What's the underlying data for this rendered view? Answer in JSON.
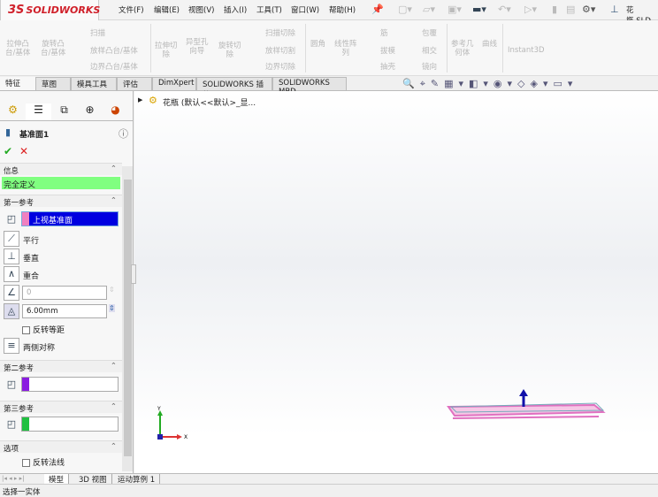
{
  "app": {
    "logo_ds": "3S",
    "logo_text": "SOLIDWORKS",
    "doc_title": "花瓶.SLD"
  },
  "menu": [
    "文件(F)",
    "编辑(E)",
    "视图(V)",
    "插入(I)",
    "工具(T)",
    "窗口(W)",
    "帮助(H)"
  ],
  "ribbon": {
    "extrude_boss": "拉伸凸\n台/基体",
    "revolve_boss": "旋转凸\n台/基体",
    "sweep": "扫描",
    "loft": "放样凸台/基体",
    "boundary": "边界凸台/基体",
    "extrude_cut": "拉伸切\n除",
    "hole_wizard": "异型孔\n向导",
    "revolve_cut": "旋转切\n除",
    "swept_cut": "扫描切除",
    "lofted_cut": "放样切割",
    "boundary_cut": "边界切除",
    "fillet": "圆角",
    "linear_pattern": "线性阵\n列",
    "rib": "筋",
    "draft": "拔模",
    "shell": "抽壳",
    "wrap": "包覆",
    "intersect": "相交",
    "mirror": "镜向",
    "ref_geometry": "参考几\n何体",
    "curves": "曲线",
    "instant3d": "Instant3D"
  },
  "tabs": [
    "特征",
    "草图",
    "模具工具",
    "评估",
    "DimXpert",
    "SOLIDWORKS 插件",
    "SOLIDWORKS MBD"
  ],
  "tree": {
    "root": "花瓶  (默认<<默认>_显..."
  },
  "panel": {
    "title": "基准面1",
    "info_header": "信息",
    "info_status": "完全定义",
    "ref1_header": "第一参考",
    "ref1_value": "上视基准面",
    "parallel": "平行",
    "perpendicular": "垂直",
    "coincident": "重合",
    "angle_value": "0",
    "distance_value": "6.00mm",
    "flip_offset": "反转等距",
    "mid_plane": "两侧对称",
    "ref2_header": "第二参考",
    "ref3_header": "第三参考",
    "options_header": "选项",
    "flip_normal": "反转法线",
    "colors": {
      "ref1": "#f080c0",
      "ref2": "#8a1ce0",
      "ref3": "#20c040",
      "info_bg": "#80ff80"
    }
  },
  "bottom_tabs": [
    "模型",
    "3D 视图",
    "运动算例 1"
  ],
  "status": "选择一实体",
  "triad": {
    "y": "Y",
    "x": "X"
  }
}
